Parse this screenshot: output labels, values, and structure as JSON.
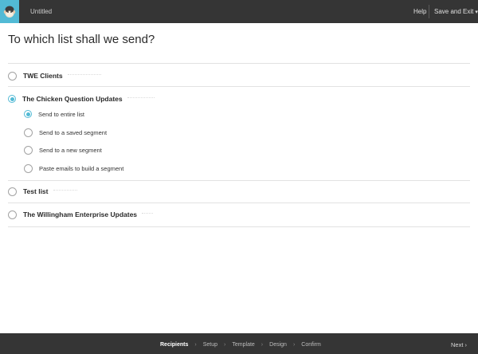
{
  "header": {
    "doc_title": "Untitled",
    "help": "Help",
    "save_exit": "Save and Exit",
    "accent": "#52bad5"
  },
  "main": {
    "title": "To which list shall we send?",
    "lists": [
      {
        "label": "TWE Clients",
        "checked": false
      },
      {
        "label": "The Chicken Question Updates",
        "checked": true
      },
      {
        "label": "Test list",
        "checked": false
      },
      {
        "label": "The Willingham Enterprise Updates",
        "checked": false
      }
    ],
    "segment_options": [
      {
        "label": "Send to entire list",
        "checked": true
      },
      {
        "label": "Send to a saved segment",
        "checked": false
      },
      {
        "label": "Send to a new segment",
        "checked": false
      },
      {
        "label": "Paste emails to build a segment",
        "checked": false
      }
    ]
  },
  "footer": {
    "steps": [
      "Recipients",
      "Setup",
      "Template",
      "Design",
      "Confirm"
    ],
    "active_step": "Recipients",
    "next": "Next"
  }
}
